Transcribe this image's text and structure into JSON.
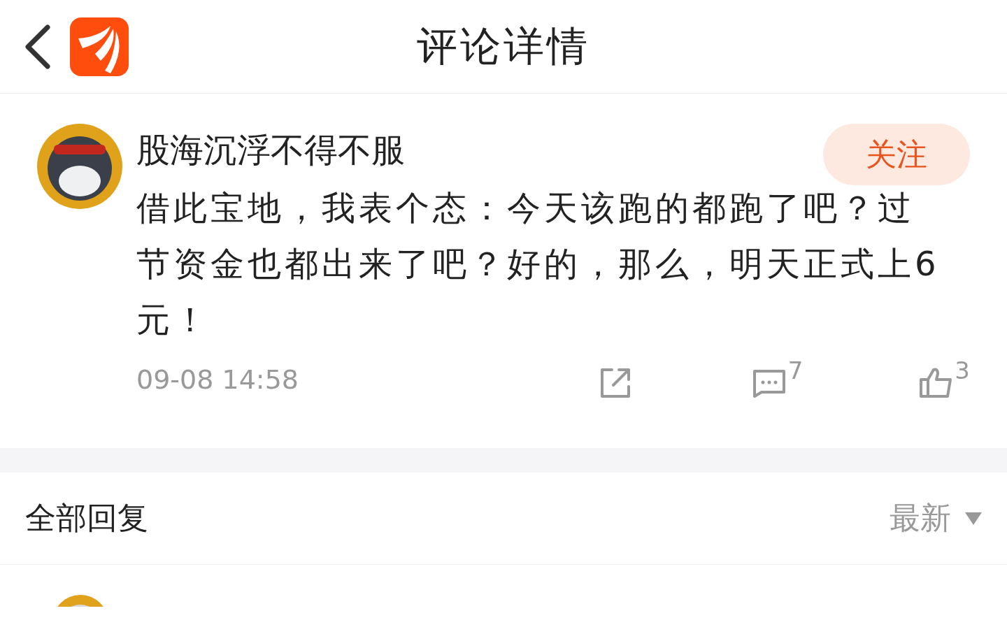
{
  "header": {
    "title": "评论详情"
  },
  "comment": {
    "author": "股海沉浮不得不服",
    "follow_label": "关注",
    "text": "借此宝地，我表个态：今天该跑的都跑了吧？过节资金也都出来了吧？好的，那么，明天正式上6元！",
    "time": "09-08 14:58",
    "reply_count": "7",
    "like_count": "3"
  },
  "replies": {
    "title": "全部回复",
    "sort": "最新"
  }
}
